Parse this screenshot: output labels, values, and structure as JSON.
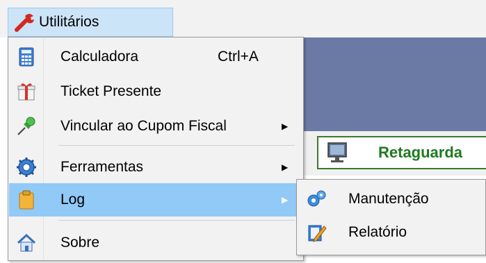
{
  "menubar": {
    "title": "Utilitários",
    "icon": "wrench-icon"
  },
  "background": {
    "window_label": "Retaguarda",
    "icon": "monitor-icon"
  },
  "menu": {
    "items": [
      {
        "label": "Calculadora",
        "shortcut": "Ctrl+A",
        "icon": "calculator-icon"
      },
      {
        "label": "Ticket Presente",
        "icon": "gift-icon"
      },
      {
        "label": "Vincular ao Cupom Fiscal",
        "icon": "pushpin-icon",
        "submenu_arrow": "▶"
      },
      {
        "label": "Ferramentas",
        "icon": "gear-icon",
        "submenu_arrow": "▶"
      },
      {
        "label": "Log",
        "icon": "clipboard-icon",
        "submenu_arrow": "▶",
        "highlighted": true
      },
      {
        "label": "Sobre",
        "icon": "home-icon"
      }
    ]
  },
  "submenu": {
    "items": [
      {
        "label": "Manutenção",
        "icon": "gears-icon"
      },
      {
        "label": "Relatório",
        "icon": "edit-icon"
      }
    ]
  },
  "colors": {
    "highlight": "#91c9f7",
    "menu_bg": "#f2f2f2",
    "top_item_bg": "#cce4f7",
    "bg_window": "#6b7aa5",
    "retaguarda_text": "#1f7a1f"
  }
}
